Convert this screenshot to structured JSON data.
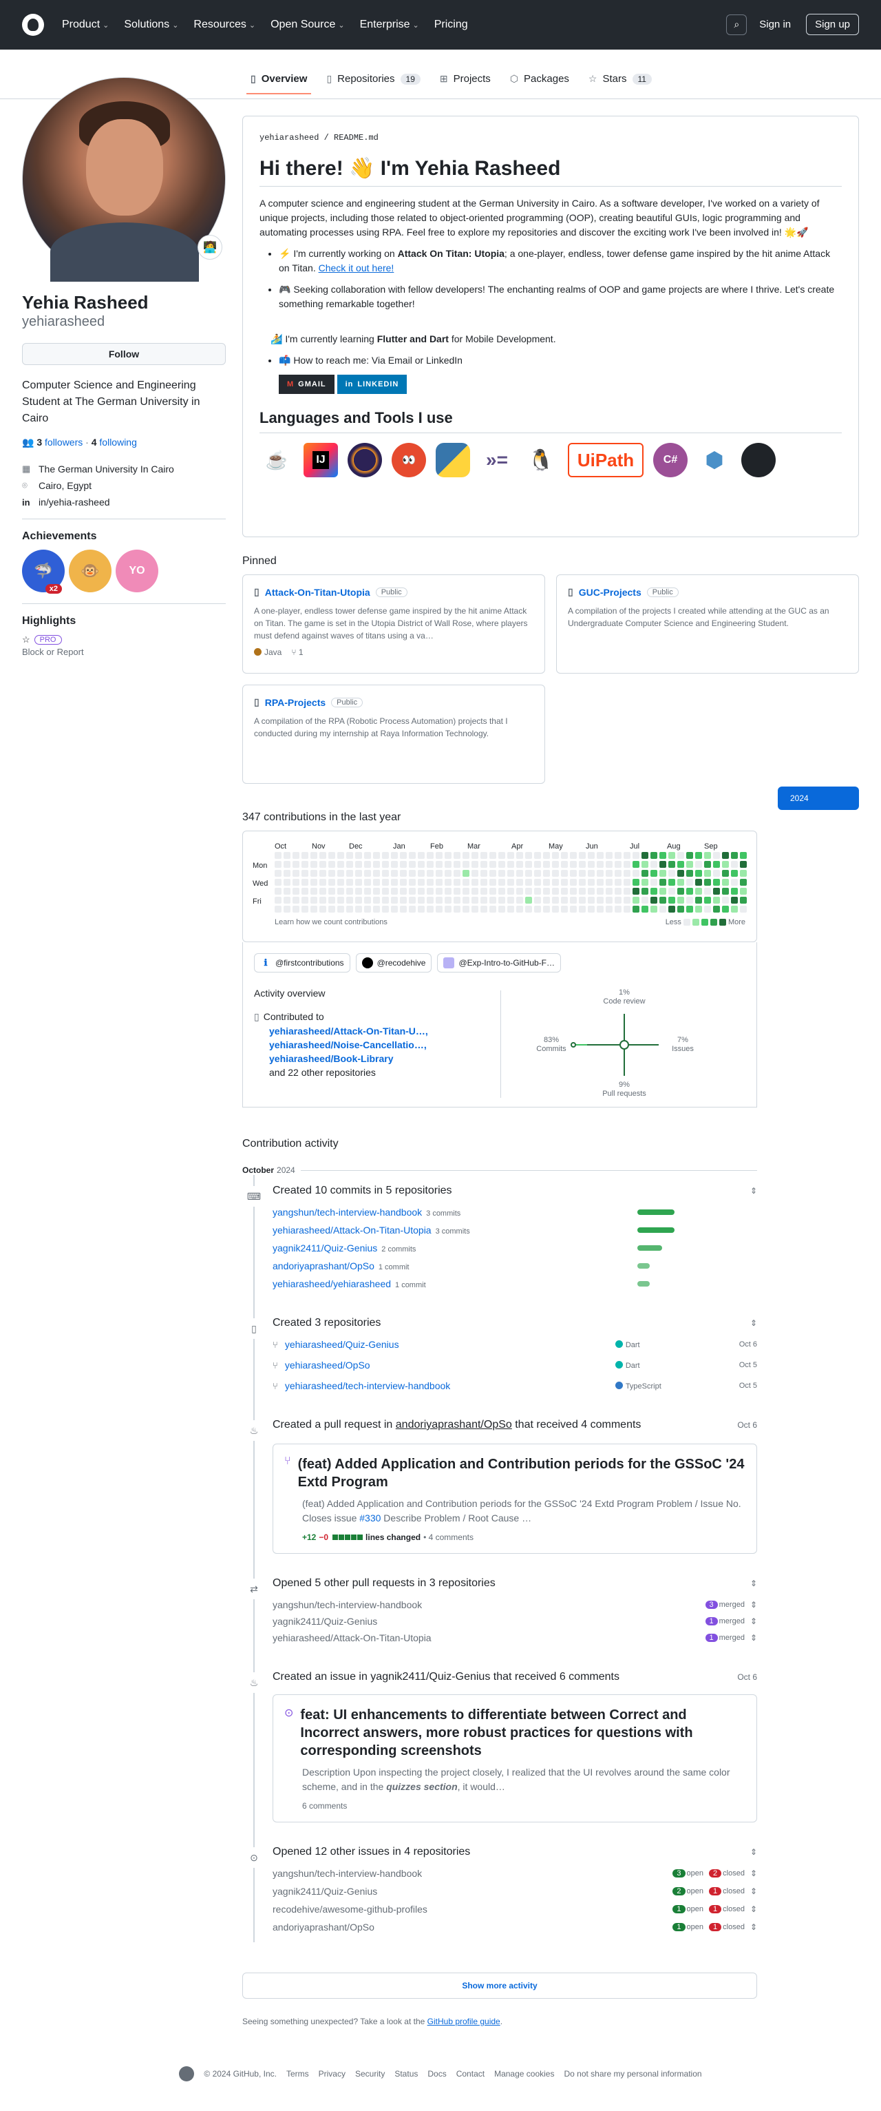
{
  "header": {
    "nav": [
      "Product",
      "Solutions",
      "Resources",
      "Open Source",
      "Enterprise",
      "Pricing"
    ],
    "sign_in": "Sign in",
    "sign_up": "Sign up"
  },
  "tabs": [
    {
      "label": "Overview",
      "count": ""
    },
    {
      "label": "Repositories",
      "count": "19"
    },
    {
      "label": "Projects",
      "count": ""
    },
    {
      "label": "Packages",
      "count": ""
    },
    {
      "label": "Stars",
      "count": "11"
    }
  ],
  "profile": {
    "name": "Yehia Rasheed",
    "login": "yehiarasheed",
    "follow": "Follow",
    "bio": "Computer Science and Engineering Student at The German University in Cairo",
    "followers_count": "3",
    "followers_label": "followers",
    "following_count": "4",
    "following_label": "following",
    "org": "The German University In Cairo",
    "location": "Cairo, Egypt",
    "linkedin": "in/yehia-rasheed",
    "achievements_title": "Achievements",
    "achievement_multiplier": "x2",
    "highlights_title": "Highlights",
    "pro": "PRO",
    "block": "Block or Report"
  },
  "readme": {
    "path_user": "yehiarasheed",
    "path_file": "README.md",
    "title": "Hi there! 👋 I'm Yehia Rasheed",
    "intro": "A computer science and engineering student at the German University in Cairo. As a software developer, I've worked on a variety of unique projects, including those related to object-oriented programming (OOP), creating beautiful GUIs, logic programming and automating processes using RPA. Feel free to explore my repositories and discover the exciting work I've been involved in! 🌟🚀",
    "item1_pre": "⚡ I'm currently working on ",
    "item1_bold": "Attack On Titan: Utopia",
    "item1_post": "; a one-player, endless, tower defense game inspired by the hit anime Attack on Titan. ",
    "item1_link": "Check it out here!",
    "item2": "🎮 Seeking collaboration with fellow developers! The enchanting realms of OOP and game projects are where I thrive. Let's create something remarkable together!",
    "item3_pre": "I'm currently learning ",
    "item3_bold": "Flutter and Dart",
    "item3_post": " for Mobile Development.",
    "item4": "📫 How to reach me: Via Email or LinkedIn",
    "badge_gmail": "GMAIL",
    "badge_linkedin": "LINKEDIN",
    "tools_title": "Languages and Tools I use",
    "tools": [
      "java-icon",
      "intellij-icon",
      "eclipse-icon",
      "scene-builder-icon",
      "python-icon",
      "haskell-icon",
      "linux-icon",
      "uipath-icon",
      "csharp-icon",
      "netlogo-icon",
      "github-icon"
    ],
    "uipath_text": "UiPath"
  },
  "pinned": {
    "title": "Pinned",
    "public": "Public",
    "items": [
      {
        "name": "Attack-On-Titan-Utopia",
        "desc": "A one-player, endless tower defense game inspired by the hit anime Attack on Titan. The game is set in the Utopia District of Wall Rose, where players must defend against waves of titans using a va…",
        "lang": "Java",
        "forks": "1"
      },
      {
        "name": "GUC-Projects",
        "desc": "A compilation of the projects I created while attending at the GUC as an Undergraduate Computer Science and Engineering Student.",
        "lang": "",
        "forks": ""
      },
      {
        "name": "RPA-Projects",
        "desc": "A compilation of the RPA (Robotic Process Automation) projects that I conducted during my internship at Raya Information Technology.",
        "lang": "",
        "forks": ""
      }
    ]
  },
  "contrib": {
    "title": "347 contributions in the last year",
    "year": "2024",
    "months": [
      "Oct",
      "Nov",
      "Dec",
      "Jan",
      "Feb",
      "Mar",
      "Apr",
      "May",
      "Jun",
      "Jul",
      "Aug",
      "Sep"
    ],
    "days": [
      "Mon",
      "Wed",
      "Fri"
    ],
    "learn": "Learn how we count contributions",
    "less": "Less",
    "more": "More",
    "chips": [
      "@firstcontributions",
      "@recodehive",
      "@Exp-Intro-to-GitHub-F…"
    ],
    "activity_overview": "Activity overview",
    "contributed_to": "Contributed to",
    "repos": [
      "yehiarasheed/Attack-On-Titan-U…,",
      "yehiarasheed/Noise-Cancellatio…,",
      "yehiarasheed/Book-Library"
    ],
    "other": "and 22 other repositories",
    "axes": {
      "code_review_pct": "1%",
      "code_review": "Code review",
      "commits_pct": "83%",
      "commits": "Commits",
      "issues_pct": "7%",
      "issues": "Issues",
      "pr_pct": "9%",
      "pr": "Pull requests"
    }
  },
  "activity": {
    "title": "Contribution activity",
    "month": "October",
    "year": "2024",
    "commits_title": "Created 10 commits in 5 repositories",
    "commits": [
      {
        "repo": "yangshun/tech-interview-handbook",
        "n": "3 commits",
        "w": 0.3
      },
      {
        "repo": "yehiarasheed/Attack-On-Titan-Utopia",
        "n": "3 commits",
        "w": 0.3
      },
      {
        "repo": "yagnik2411/Quiz-Genius",
        "n": "2 commits",
        "w": 0.2
      },
      {
        "repo": "andoriyaprashant/OpSo",
        "n": "1 commit",
        "w": 0.1
      },
      {
        "repo": "yehiarasheed/yehiarasheed",
        "n": "1 commit",
        "w": 0.1
      }
    ],
    "repos_title": "Created 3 repositories",
    "repos": [
      {
        "name": "yehiarasheed/Quiz-Genius",
        "lang": "Dart",
        "color": "#00b4ab",
        "date": "Oct 6"
      },
      {
        "name": "yehiarasheed/OpSo",
        "lang": "Dart",
        "color": "#00b4ab",
        "date": "Oct 5"
      },
      {
        "name": "yehiarasheed/tech-interview-handbook",
        "lang": "TypeScript",
        "color": "#3178c6",
        "date": "Oct 5"
      }
    ],
    "pr_title_pre": "Created a pull request in ",
    "pr_title_repo": "andoriyaprashant/OpSo",
    "pr_title_post": " that received 4 comments",
    "pr_date": "Oct 6",
    "pr_card_title": "(feat) Added Application and Contribution periods for the GSSoC '24 Extd Program",
    "pr_card_desc_pre": "(feat) Added Application and Contribution periods for the GSSoC '24 Extd Program Problem / Issue No. Closes issue ",
    "pr_card_issue": "#330",
    "pr_card_desc_post": " Describe Problem / Root Cause …",
    "pr_plus": "+12",
    "pr_minus": "−0",
    "pr_lines": "lines changed",
    "pr_comments": "• 4 comments",
    "other_prs_title": "Opened 5 other pull requests in 3 repositories",
    "other_prs": [
      {
        "repo": "yangshun/tech-interview-handbook",
        "n": "3",
        "label": "merged"
      },
      {
        "repo": "yagnik2411/Quiz-Genius",
        "n": "1",
        "label": "merged"
      },
      {
        "repo": "yehiarasheed/Attack-On-Titan-Utopia",
        "n": "1",
        "label": "merged"
      }
    ],
    "issue_title": "Created an issue in yagnik2411/Quiz-Genius that received 6 comments",
    "issue_date": "Oct 6",
    "issue_card_title": "feat: UI enhancements to differentiate between Correct and Incorrect answers, more robust practices for questions with corresponding screenshots",
    "issue_card_desc_pre": "Description Upon inspecting the project closely, I realized that the UI revolves around the same color scheme, and in the ",
    "issue_card_desc_em": "quizzes section",
    "issue_card_desc_post": ", it would…",
    "issue_comments": "6 comments",
    "other_issues_title": "Opened 12 other issues in 4 repositories",
    "other_issues": [
      {
        "repo": "yangshun/tech-interview-handbook",
        "open": "3",
        "closed": "2"
      },
      {
        "repo": "yagnik2411/Quiz-Genius",
        "open": "2",
        "closed": "1"
      },
      {
        "repo": "recodehive/awesome-github-profiles",
        "open": "1",
        "closed": "1"
      },
      {
        "repo": "andoriyaprashant/OpSo",
        "open": "1",
        "closed": "1"
      }
    ],
    "open_label": "open",
    "closed_label": "closed",
    "show_more": "Show more activity",
    "unexpected_pre": "Seeing something unexpected? Take a look at the ",
    "unexpected_link": "GitHub profile guide",
    "unexpected_post": "."
  },
  "footer": {
    "copyright": "© 2024 GitHub, Inc.",
    "links": [
      "Terms",
      "Privacy",
      "Security",
      "Status",
      "Docs",
      "Contact",
      "Manage cookies",
      "Do not share my personal information"
    ]
  }
}
